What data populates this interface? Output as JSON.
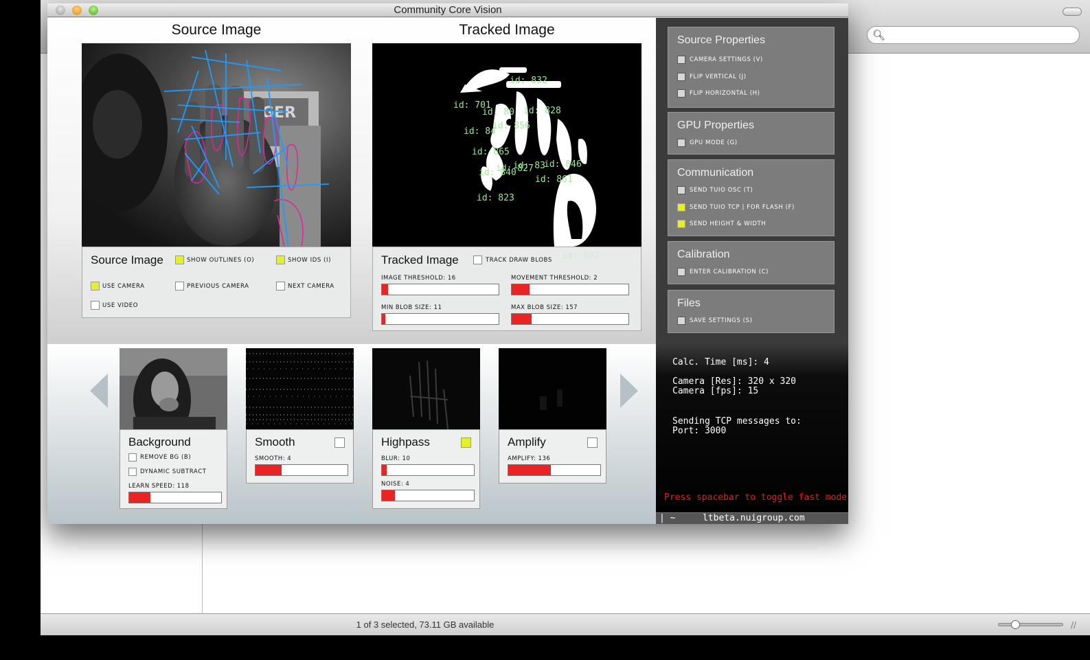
{
  "finder": {
    "search_placeholder": "",
    "status_text": "1 of 3 selected, 73.11 GB available"
  },
  "window": {
    "title": "Community Core Vision"
  },
  "source_pane": {
    "title": "Source Image",
    "controls_title": "Source Image",
    "show_outlines": {
      "label": "SHOW OUTLINES (O)",
      "checked": true
    },
    "show_ids": {
      "label": "SHOW IDS (I)",
      "checked": true
    },
    "use_camera": {
      "label": "USE CAMERA",
      "checked": true
    },
    "previous_camera": {
      "label": "PREVIOUS CAMERA",
      "checked": false
    },
    "next_camera": {
      "label": "NEXT CAMERA",
      "checked": false
    },
    "use_video": {
      "label": "USE VIDEO",
      "checked": false
    }
  },
  "tracked_pane": {
    "title": "Tracked Image",
    "controls_title": "Tracked Image",
    "track_dark_blobs": {
      "label": "TRACK DRAW BLOBS",
      "checked": false
    },
    "blob_ids": [
      "id: 832",
      "id: 701",
      "id: 80",
      "id: 828",
      "id: 856",
      "id: 84",
      "id: 865",
      "id: 827",
      "id: 840",
      "id: 83",
      "id: 846",
      "id: 861",
      "id: 823",
      "id: 802"
    ],
    "sliders": [
      {
        "label": "IMAGE THRESHOLD: 16",
        "value": 0.05
      },
      {
        "label": "MOVEMENT THRESHOLD: 2",
        "value": 0.15
      },
      {
        "label": "MIN BLOB SIZE: 11",
        "value": 0.03
      },
      {
        "label": "MAX BLOB SIZE: 157",
        "value": 0.17
      }
    ]
  },
  "side_panel": {
    "source_properties": {
      "title": "Source Properties",
      "items": [
        {
          "label": "CAMERA SETTINGS (V)",
          "checked": false
        },
        {
          "label": "FLIP VERTICAL (J)",
          "checked": false
        },
        {
          "label": "FLIP HORIZONTAL (H)",
          "checked": false
        }
      ]
    },
    "gpu_properties": {
      "title": "GPU Properties",
      "items": [
        {
          "label": "GPU MODE (G)",
          "checked": false
        }
      ]
    },
    "communication": {
      "title": "Communication",
      "items": [
        {
          "label": "SEND TUIO OSC (T)",
          "checked": false
        },
        {
          "label": "SEND TUIO TCP | FOR FLASH (F)",
          "checked": true
        },
        {
          "label": "SEND HEIGHT & WIDTH",
          "checked": true
        }
      ]
    },
    "calibration": {
      "title": "Calibration",
      "items": [
        {
          "label": "ENTER CALIBRATION (C)",
          "checked": false
        }
      ]
    },
    "files": {
      "title": "Files",
      "items": [
        {
          "label": "SAVE SETTINGS (S)",
          "checked": false
        }
      ]
    }
  },
  "filters": {
    "background": {
      "title": "Background",
      "remove_bg": {
        "label": "REMOVE BG (B)",
        "checked": false
      },
      "dynamic_subtract": {
        "label": "DYNAMIC SUBTRACT",
        "checked": false
      },
      "slider": {
        "label": "LEARN SPEED: 118",
        "value": 0.23
      }
    },
    "smooth": {
      "title": "Smooth",
      "checked": false,
      "slider": {
        "label": "SMOOTH: 4",
        "value": 0.28
      }
    },
    "highpass": {
      "title": "Highpass",
      "checked": true,
      "blur": {
        "label": "BLUR: 10",
        "value": 0.05
      },
      "noise": {
        "label": "NOISE: 4",
        "value": 0.14
      }
    },
    "amplify": {
      "title": "Amplify",
      "checked": false,
      "slider": {
        "label": "AMPLIFY: 136",
        "value": 0.46
      }
    }
  },
  "info": {
    "calc_time": "Calc. Time [ms]:  4",
    "camera_res": "Camera [Res]:     320 x 320",
    "camera_fps": "Camera [fps]:      15",
    "sending_to": "Sending TCP messages to:",
    "port": "Port: 3000",
    "fast_mode": "Press spacebar to toggle fast mode",
    "footer_left": "| ~",
    "footer_url": "ltbeta.nuigroup.com"
  },
  "colors": {
    "checkbox_on": "#e6f029",
    "slider_fill": "#ea2424",
    "blob_id_text": "#9fe89f",
    "outline_pink": "#e0249a",
    "tracking_blue": "#1e9bff",
    "fast_mode_text": "#ee1a1a"
  }
}
